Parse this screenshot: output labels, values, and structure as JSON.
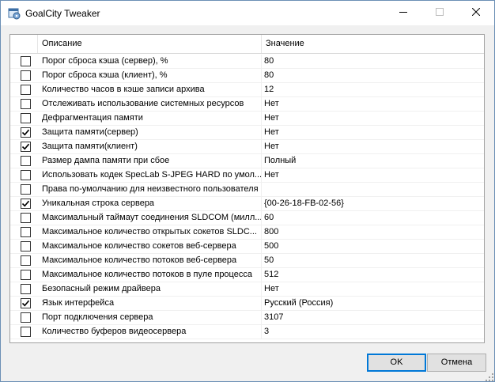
{
  "window": {
    "title": "GoalCity Tweaker"
  },
  "icons": {
    "app": "app-icon",
    "minimize": "minimize-icon",
    "maximize": "maximize-icon",
    "close": "close-icon",
    "check": "checkmark-icon"
  },
  "grid": {
    "header_desc": "Описание",
    "header_value": "Значение",
    "rows": [
      {
        "checked": false,
        "desc": "Порог сброса кэша (сервер), %",
        "value": "80"
      },
      {
        "checked": false,
        "desc": "Порог сброса кэша (клиент), %",
        "value": "80"
      },
      {
        "checked": false,
        "desc": "Количество часов в кэше записи архива",
        "value": "12"
      },
      {
        "checked": false,
        "desc": "Отслеживать использование системных ресурсов",
        "value": "Нет"
      },
      {
        "checked": false,
        "desc": "Дефрагментация памяти",
        "value": "Нет"
      },
      {
        "checked": true,
        "desc": "Защита памяти(сервер)",
        "value": "Нет"
      },
      {
        "checked": true,
        "desc": "Защита памяти(клиент)",
        "value": "Нет"
      },
      {
        "checked": false,
        "desc": "Размер дампа памяти при сбое",
        "value": "Полный"
      },
      {
        "checked": false,
        "desc": "Использовать кодек SpecLab S-JPEG HARD по умол...",
        "value": "Нет"
      },
      {
        "checked": false,
        "desc": "Права по-умолчанию для неизвестного пользователя",
        "value": ""
      },
      {
        "checked": true,
        "desc": "Уникальная строка сервера",
        "value": "{00-26-18-FB-02-56}"
      },
      {
        "checked": false,
        "desc": "Максимальный таймаут соединения SLDCOM (милл...",
        "value": "60"
      },
      {
        "checked": false,
        "desc": "Максимальное количество открытых сокетов SLDC...",
        "value": "800"
      },
      {
        "checked": false,
        "desc": "Максимальное количество сокетов веб-сервера",
        "value": "500"
      },
      {
        "checked": false,
        "desc": "Максимальное количество потоков веб-сервера",
        "value": "50"
      },
      {
        "checked": false,
        "desc": "Максимальное количество потоков в пуле процесса",
        "value": "512"
      },
      {
        "checked": false,
        "desc": "Безопасный режим драйвера",
        "value": "Нет"
      },
      {
        "checked": true,
        "desc": "Язык интерфейса",
        "value": "Русский (Россия)"
      },
      {
        "checked": false,
        "desc": "Порт подключения сервера",
        "value": "3107"
      },
      {
        "checked": false,
        "desc": "Количество буферов видеосервера",
        "value": "3"
      }
    ]
  },
  "buttons": {
    "ok": "OK",
    "cancel": "Отмена"
  },
  "colors": {
    "accent": "#0078d7",
    "window_border": "#6b8fb5",
    "background": "#f0f0f0"
  }
}
